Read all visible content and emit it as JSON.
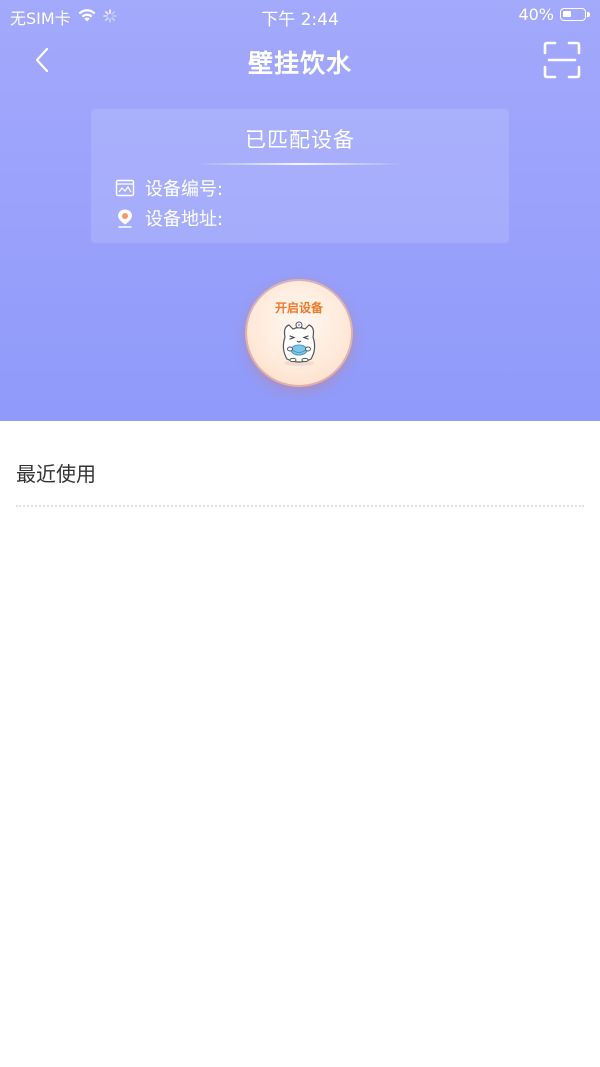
{
  "status_bar": {
    "carrier": "无SIM卡",
    "time": "下午 2:44",
    "battery_percent": "40%",
    "battery_level": 0.4
  },
  "nav": {
    "title": "壁挂饮水",
    "back_icon": "chevron-left-icon",
    "scan_icon": "scan-icon"
  },
  "device_card": {
    "title": "已匹配设备",
    "rows": [
      {
        "icon": "device-id-icon",
        "label": "设备编号:"
      },
      {
        "icon": "location-pin-icon",
        "label": "设备地址:"
      }
    ]
  },
  "start_button": {
    "label": "开启设备",
    "icon": "hamster-mascot-icon"
  },
  "recent": {
    "title": "最近使用"
  },
  "colors": {
    "hero_top": "#a3a9fb",
    "hero_bottom": "#8f9afa",
    "accent_orange": "#f07a2a",
    "text_dark": "#333333"
  }
}
